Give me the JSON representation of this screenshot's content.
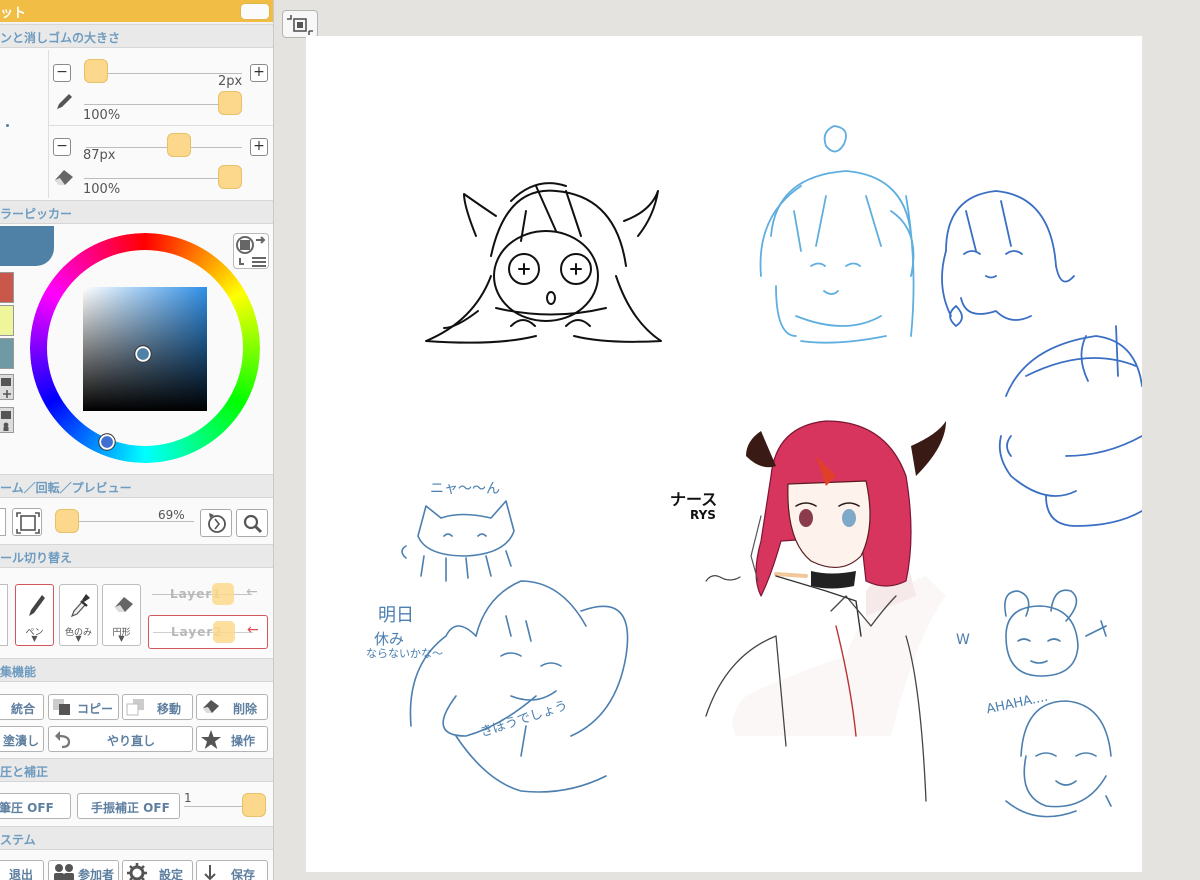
{
  "palette": {
    "title": "ット",
    "sections": {
      "pen_eraser_size": "ンと消しゴムの大きさ",
      "color_picker": "ラーピッカー",
      "zoom_rotate_preview": "ーム／回転／プレビュー",
      "tool_switch": "ール切り替え",
      "edit_functions": "集機能",
      "pressure_correction": "圧と補正",
      "system": "ステム"
    },
    "pen": {
      "size_value": "2px",
      "opacity_value": "100%",
      "size_fraction": 0.0,
      "opacity_fraction": 1.0
    },
    "eraser": {
      "size_value": "87px",
      "opacity_value": "100%",
      "size_fraction": 0.58,
      "opacity_fraction": 1.0
    },
    "minus_glyph": "−",
    "plus_glyph": "+",
    "zoom_value": "69%",
    "tools": [
      {
        "name": "pen",
        "label": "ペン",
        "caret": "▼",
        "selected": true
      },
      {
        "name": "color-only",
        "label": "色のみ",
        "caret": "▼",
        "selected": false
      },
      {
        "name": "circle",
        "label": "円形",
        "caret": "▼",
        "selected": false
      }
    ],
    "layers": [
      {
        "name": "Layer1",
        "arrow": "←",
        "selected": false
      },
      {
        "name": "Layer2",
        "arrow": "←",
        "selected": true
      }
    ],
    "edit_buttons": {
      "merge": "統合",
      "copy": "コピー",
      "move": "移動",
      "delete": "削除",
      "fill": "塗潰し",
      "redo": "やり直し",
      "operation": "操作"
    },
    "pressure_button": "筆圧 OFF",
    "stabilizer_button": "手振補正 OFF",
    "stabilizer_value": "1",
    "system_buttons": {
      "exit": "退出",
      "participants": "参加者",
      "settings": "設定",
      "save": "保存"
    },
    "colors": {
      "accent": "#f2bd45",
      "section_text": "#6e9cc0",
      "current_color": "#4f80a5",
      "swatch_1": "#c9584a",
      "swatch_2": "#eef59a",
      "swatch_3": "#6f9aa3",
      "layer_active": "#e04a55"
    }
  },
  "canvas": {
    "texts": {
      "nyaa": "ニャ〜〜ん",
      "nurse": "ナース",
      "rys": "RYS",
      "tomorrow": "明日",
      "holiday": "休み",
      "naranai": "ならないかな〜",
      "kiboudeshou": "きぼうでしょう",
      "ahaha": "AHAHA....",
      "w": "W"
    }
  }
}
